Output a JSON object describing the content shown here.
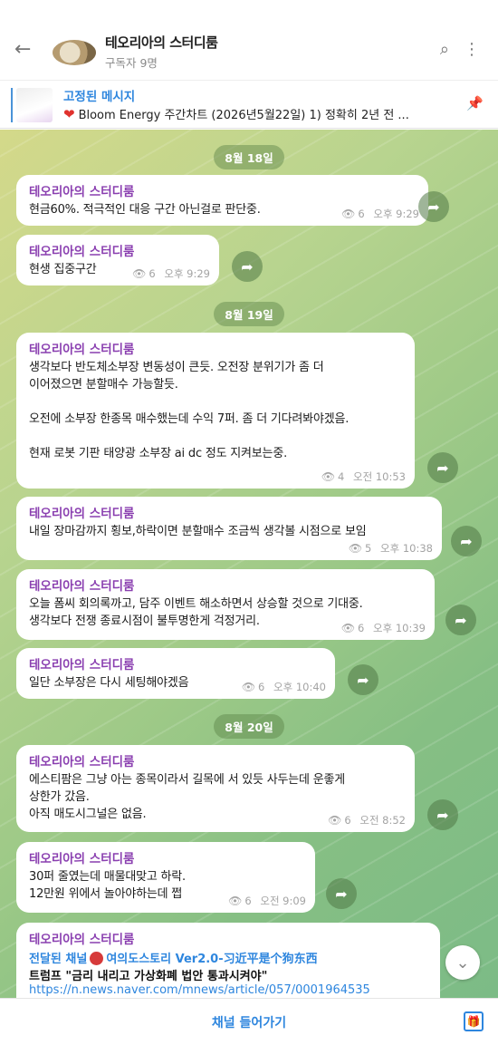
{
  "window": {
    "minimize": "—",
    "maximize": "☐",
    "close": "✕"
  },
  "header": {
    "title": "테오리아의 스터디룸",
    "subtitle": "구독자 9명"
  },
  "pinned": {
    "label": "고정된 메시지",
    "text": "Bloom Energy 주간차트 (2026년5월22일)  1) 정확히 2년 전 ..."
  },
  "sender": "테오리아의 스터디룸",
  "dates": [
    "8월 18일",
    "8월 19일",
    "8월 20일"
  ],
  "messages": [
    {
      "text": "현금60%. 적극적인 대응 구간 아닌걸로 판단중.",
      "views": "6",
      "time": "오후 9:29"
    },
    {
      "text": "현생 집중구간",
      "views": "6",
      "time": "오후 9:29"
    },
    {
      "text": "생각보다 반도체소부장 변동성이 큰듯. 오전장 분위기가 좀 더\n이어졌으면 분할매수 가능할듯.\n\n오전에 소부장 한종목 매수했는데 수익 7퍼. 좀 더 기다려봐야겠음.\n\n현재 로봇 기판 태양광 소부장 ai dc 정도 지켜보는중.",
      "views": "4",
      "time": "오전 10:53"
    },
    {
      "text": "내일 장마감까지 횡보,하락이면 분할매수 조금씩 생각볼 시점으로 보임",
      "views": "5",
      "time": "오후 10:38"
    },
    {
      "text": "오늘 폼씨 회의록까고, 담주 이벤트 해소하면서 상승할 것으로 기대중.\n생각보다 전쟁 종료시점이 불투명한게 걱정거리.",
      "views": "6",
      "time": "오후 10:39"
    },
    {
      "text": "일단 소부장은 다시 세팅해야겠음",
      "views": "6",
      "time": "오후 10:40"
    },
    {
      "text": "에스티팜은 그냥 아는 종목이라서 길목에 서 있듯 사두는데 운좋게\n상한가 갔음.\n아직 매도시그널은 없음.",
      "views": "6",
      "time": "오전 8:52"
    },
    {
      "text": "30퍼 줄였는데 매물대맞고 하락.\n12만원 위에서 놀아야하는데 쩝",
      "views": "6",
      "time": "오전 9:09"
    }
  ],
  "last": {
    "forward_prefix": "전달된 채널",
    "forward_source": "여의도스토리 Ver2.0-习近平是个狗东西",
    "headline": "트럼프 \"금리 내리고 가상화폐 법안 통과시켜야\"",
    "link": "https://n.news.naver.com/mnews/article/057/0001964535"
  },
  "bottom": {
    "join_label": "채널 들어가기"
  }
}
